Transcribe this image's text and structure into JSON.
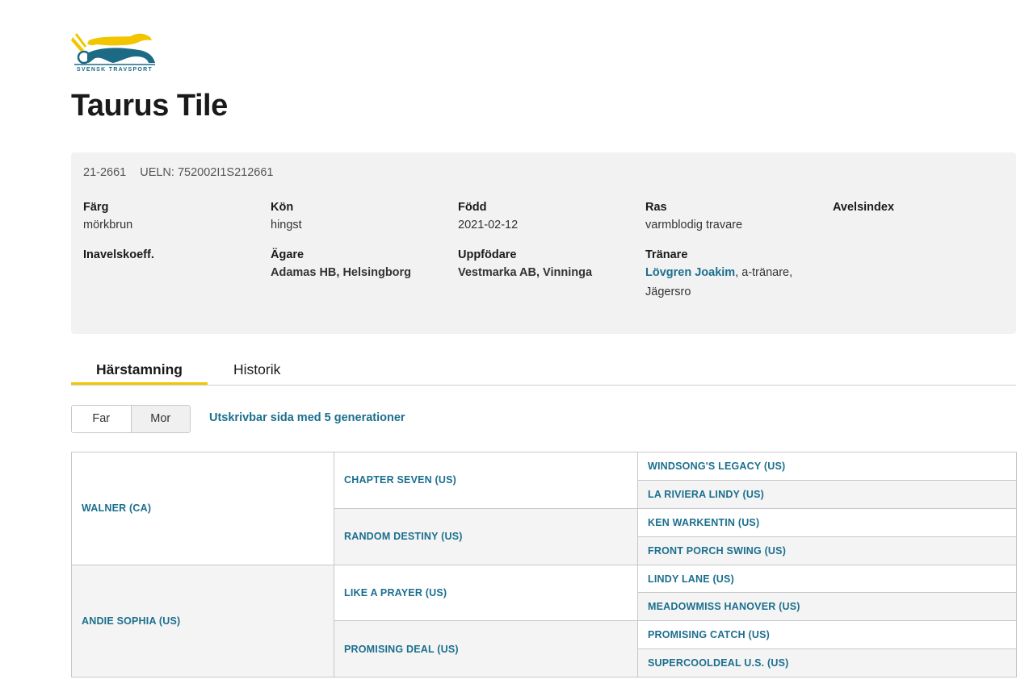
{
  "logo": {
    "text": "SVENSK TRAVSPORT"
  },
  "horse": {
    "name": "Taurus Tile",
    "reg_no": "21-2661",
    "ueln": "UELN: 752002I1S212661"
  },
  "details": {
    "color": {
      "label": "Färg",
      "value": "mörkbrun"
    },
    "sex": {
      "label": "Kön",
      "value": "hingst"
    },
    "born": {
      "label": "Född",
      "value": "2021-02-12"
    },
    "breed": {
      "label": "Ras",
      "value": "varmblodig travare"
    },
    "breeding_index": {
      "label": "Avelsindex"
    },
    "inbreeding": {
      "label": "Inavelskoeff."
    },
    "owner": {
      "label": "Ägare",
      "value": "Adamas HB, Helsingborg"
    },
    "breeder": {
      "label": "Uppfödare",
      "value": "Vestmarka AB, Vinninga"
    },
    "trainer": {
      "label": "Tränare",
      "name": "Lövgren Joakim",
      "suffix": ", a-tränare,",
      "location": "Jägersro"
    }
  },
  "tabs": [
    {
      "label": "Härstamning",
      "active": true
    },
    {
      "label": "Historik",
      "active": false
    }
  ],
  "toggle": {
    "far": "Far",
    "mor": "Mor"
  },
  "print_link": "Utskrivbar sida med 5 generationer",
  "pedigree": {
    "sire": {
      "name": "WALNER (CA)",
      "sire": {
        "name": "CHAPTER SEVEN (US)",
        "sire": "WINDSONG'S LEGACY (US)",
        "dam": "LA RIVIERA LINDY (US)"
      },
      "dam": {
        "name": "RANDOM DESTINY (US)",
        "sire": "KEN WARKENTIN (US)",
        "dam": "FRONT PORCH SWING (US)"
      }
    },
    "dam": {
      "name": "ANDIE SOPHIA (US)",
      "sire": {
        "name": "LIKE A PRAYER (US)",
        "sire": "LINDY LANE (US)",
        "dam": "MEADOWMISS HANOVER (US)"
      },
      "dam": {
        "name": "PROMISING DEAL (US)",
        "sire": "PROMISING CATCH (US)",
        "dam": "SUPERCOOLDEAL U.S. (US)"
      }
    }
  },
  "colors": {
    "link": "#1b6f8e",
    "tab_accent": "#f2c500",
    "logo_yellow": "#f2c500",
    "logo_blue": "#1d6a85"
  }
}
